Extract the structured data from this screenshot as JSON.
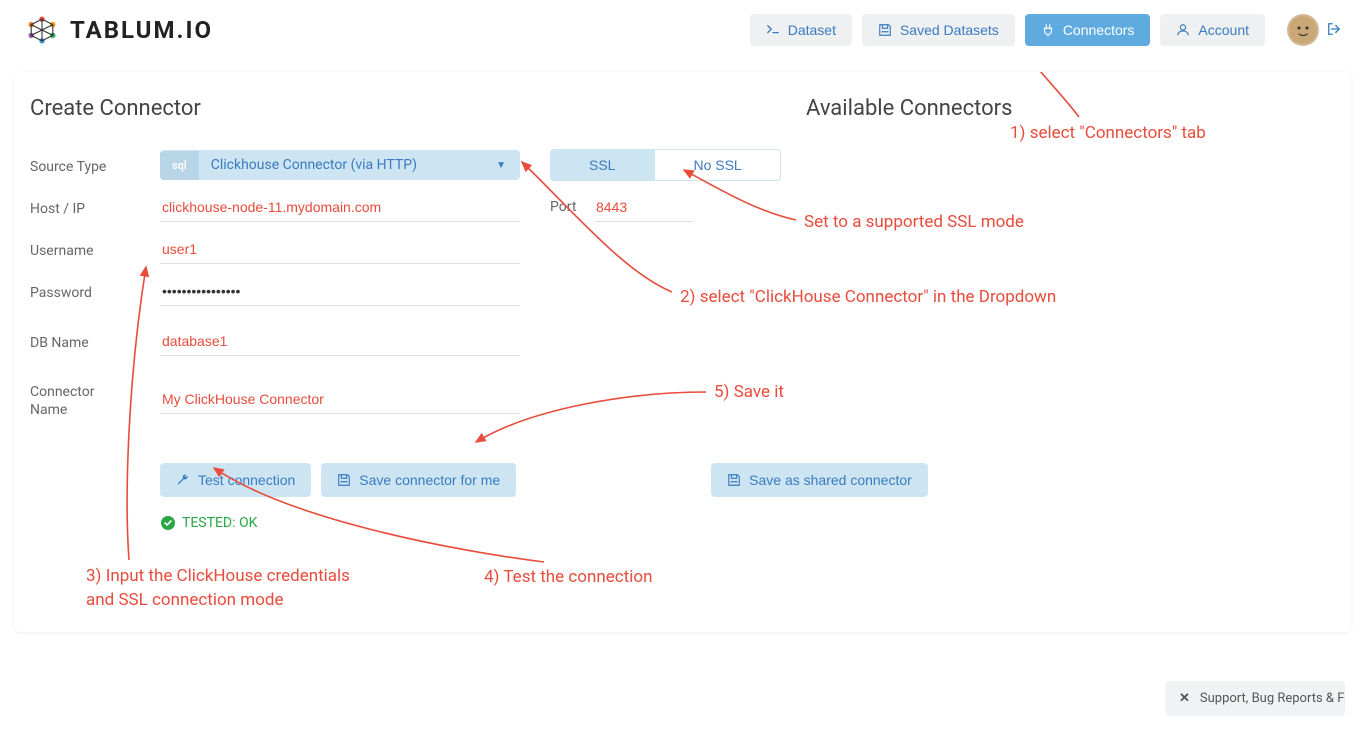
{
  "header": {
    "logo_text": "TABLUM.IO",
    "nav": {
      "dataset": "Dataset",
      "saved": "Saved Datasets",
      "connectors": "Connectors",
      "account": "Account"
    }
  },
  "page": {
    "title": "Create Connector",
    "right_title": "Available Connectors"
  },
  "form": {
    "source_type_label": "Source Type",
    "source_type_badge": "sql",
    "source_type_value": "Clickhouse Connector (via HTTP)",
    "host_label": "Host / IP",
    "host_value": "clickhouse-node-11.mydomain.com",
    "port_label": "Port",
    "port_value": "8443",
    "ssl_on": "SSL",
    "ssl_off": "No SSL",
    "username_label": "Username",
    "username_value": "user1",
    "password_label": "Password",
    "password_value": "••••••••••••••••",
    "dbname_label": "DB Name",
    "dbname_value": "database1",
    "connector_name_label_1": "Connector",
    "connector_name_label_2": "Name",
    "connector_name_value": "My ClickHouse Connector"
  },
  "actions": {
    "test": "Test connection",
    "save": "Save connector for me",
    "save_shared": "Save as shared connector"
  },
  "status": {
    "text": "TESTED: OK"
  },
  "annotations": {
    "a1": "1) select \"Connectors\" tab",
    "a2": "2) select \"ClickHouse Connector\" in the Dropdown",
    "a3_line1": "3) Input the ClickHouse credentials",
    "a3_line2": "and SSL connection mode",
    "a4": "4) Test the connection",
    "a5": "5) Save it",
    "a_ssl": "Set to a supported SSL mode"
  },
  "support": {
    "text": "Support, Bug Reports & Fe…"
  }
}
